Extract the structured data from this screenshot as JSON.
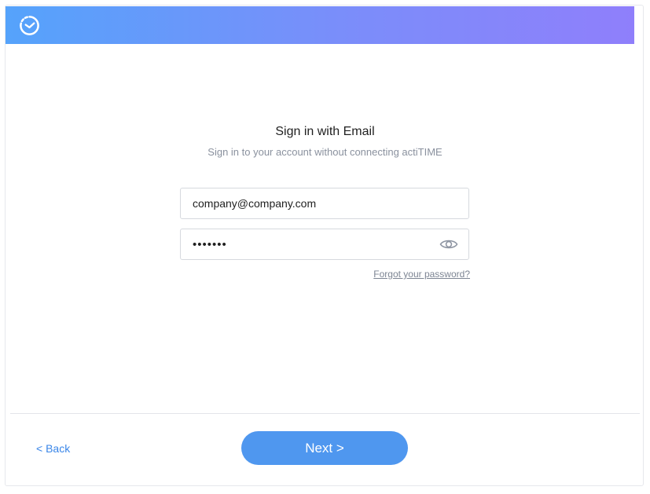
{
  "header": {
    "logo_icon": "clock-icon",
    "gradient_start": "#55a3fb",
    "gradient_end": "#8f7ffb"
  },
  "signin": {
    "title": "Sign in with Email",
    "subtitle": "Sign in to your account without connecting actiTIME",
    "email_value": "company@company.com",
    "password_value": "•••••••",
    "show_password_icon": "eye-icon",
    "forgot_link": "Forgot your password?"
  },
  "footer": {
    "back_label": "< Back",
    "next_label": "Next >",
    "accent_color": "#4f97ef"
  }
}
